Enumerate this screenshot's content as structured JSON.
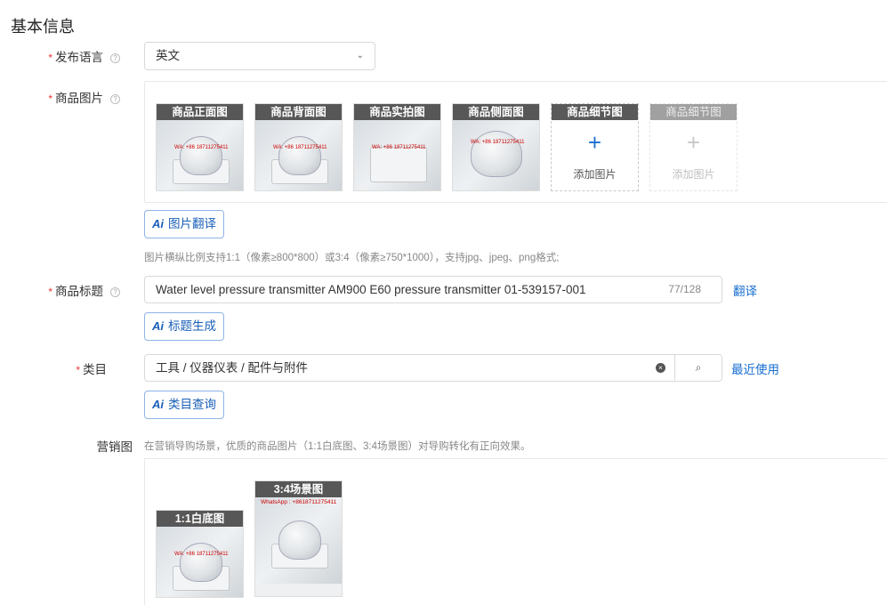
{
  "section": {
    "title": "基本信息"
  },
  "language": {
    "label": "发布语言",
    "value": "英文"
  },
  "images": {
    "label": "商品图片",
    "thumbs": [
      "商品正面图",
      "商品背面图",
      "商品实拍图",
      "商品侧面图"
    ],
    "add_tiles": [
      {
        "caption": "商品细节图",
        "text": "添加图片"
      },
      {
        "caption": "商品细节图",
        "text": "添加图片"
      }
    ],
    "watermark": "WA: +86 18711275411",
    "translate_button": "图片翻译",
    "hint": "图片横纵比例支持1:1（像素≥800*800）或3:4（像素≥750*1000），支持jpg、jpeg、png格式;"
  },
  "product_title": {
    "label": "商品标题",
    "value": "Water level pressure transmitter AM900 E60 pressure transmitter 01-539157-001",
    "count": "77/128",
    "translate_link": "翻译",
    "generate_button": "标题生成"
  },
  "category": {
    "label": "类目",
    "value": "工具 / 仪器仪表 / 配件与附件",
    "recent_link": "最近使用",
    "query_button": "类目查询"
  },
  "marketing": {
    "label": "营销图",
    "hint": "在营销导购场景，优质的商品图片（1:1白底图、3:4场景图）对导购转化有正向效果。",
    "images": [
      "1:1白底图",
      "3:4场景图"
    ],
    "scene_watermark": "WhatsApp : +8618711275411"
  },
  "colors": {
    "accent": "#1a6fd1",
    "required": "#e33333"
  }
}
